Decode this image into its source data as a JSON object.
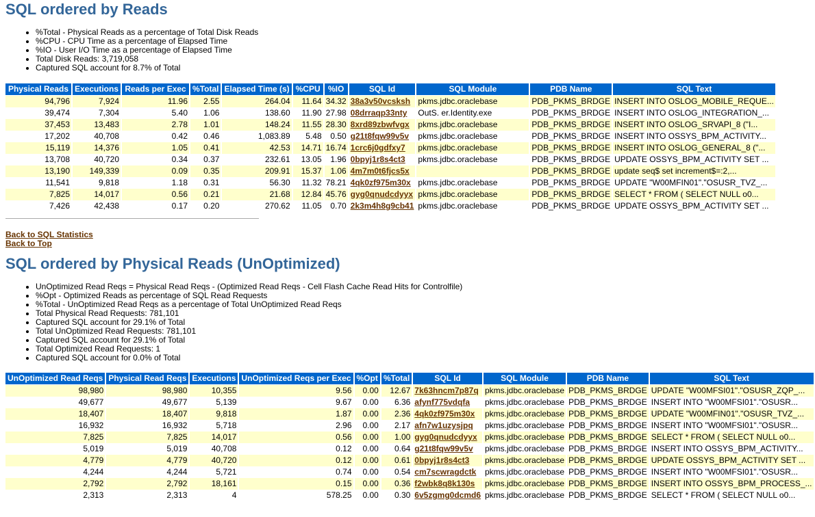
{
  "section1": {
    "title": "SQL ordered by Reads",
    "notes": [
      "%Total - Physical Reads as a percentage of Total Disk Reads",
      "%CPU - CPU Time as a percentage of Elapsed Time",
      "%IO - User I/O Time as a percentage of Elapsed Time",
      "Total Disk Reads: 3,719,058",
      "Captured SQL account for 8.7% of Total"
    ],
    "columns": [
      "Physical Reads",
      "Executions",
      "Reads per Exec",
      "%Total",
      "Elapsed Time (s)",
      "%CPU",
      "%IO",
      "SQL Id",
      "SQL Module",
      "PDB Name",
      "SQL Text"
    ],
    "rows": [
      [
        "94,796",
        "7,924",
        "11.96",
        "2.55",
        "264.04",
        "11.64",
        "34.32",
        "38a3v50vcsksh",
        "pkms.jdbc.oraclebase",
        "PDB_PKMS_BRDGE",
        "INSERT INTO OSLOG_MOBILE_REQUE..."
      ],
      [
        "39,474",
        "7,304",
        "5.40",
        "1.06",
        "138.60",
        "11.90",
        "27.98",
        "08drraqp33nty",
        "OutS.                    er.Identity.exe",
        "PDB_PKMS_BRDGE",
        "INSERT INTO OSLOG_INTEGRATION_..."
      ],
      [
        "37,453",
        "13,483",
        "2.78",
        "1.01",
        "148.24",
        "11.55",
        "28.30",
        "8xrd89zbwfvgx",
        "pkms.jdbc.oraclebase",
        "PDB_PKMS_BRDGE",
        "INSERT INTO OSLOG_SRVAPI_8 (\"I..."
      ],
      [
        "17,202",
        "40,708",
        "0.42",
        "0.46",
        "1,083.89",
        "5.48",
        "0.50",
        "g21t8fqw99v5v",
        "pkms.jdbc.oraclebase",
        "PDB_PKMS_BRDGE",
        "INSERT INTO OSSYS_BPM_ACTIVITY..."
      ],
      [
        "15,119",
        "14,376",
        "1.05",
        "0.41",
        "42.53",
        "14.71",
        "16.74",
        "1crc6j0gdfxy7",
        "pkms.jdbc.oraclebase",
        "PDB_PKMS_BRDGE",
        "INSERT INTO OSLOG_GENERAL_8 (\"..."
      ],
      [
        "13,708",
        "40,720",
        "0.34",
        "0.37",
        "232.61",
        "13.05",
        "1.96",
        "0bpyj1r8s4ct3",
        "pkms.jdbc.oraclebase",
        "PDB_PKMS_BRDGE",
        "UPDATE OSSYS_BPM_ACTIVITY SET ..."
      ],
      [
        "13,190",
        "149,339",
        "0.09",
        "0.35",
        "209.91",
        "15.37",
        "1.06",
        "4m7m0t6fjcs5x",
        "",
        "PDB_PKMS_BRDGE",
        "update seq$ set increment$=:2,..."
      ],
      [
        "11,541",
        "9,818",
        "1.18",
        "0.31",
        "56.30",
        "11.32",
        "78.21",
        "4qk0zf975m30x",
        "pkms.jdbc.oraclebase",
        "PDB_PKMS_BRDGE",
        "UPDATE \"W00MFIN01\".\"OSUSR_TVZ_..."
      ],
      [
        "7,825",
        "14,017",
        "0.56",
        "0.21",
        "21.68",
        "12.84",
        "45.76",
        "gyg0qnudcdyyx",
        "pkms.jdbc.oraclebase",
        "PDB_PKMS_BRDGE",
        "SELECT * FROM ( SELECT NULL o0..."
      ],
      [
        "7,426",
        "42,438",
        "0.17",
        "0.20",
        "270.62",
        "11.05",
        "0.70",
        "2k3m4h8g9cb41",
        "pkms.jdbc.oraclebase",
        "PDB_PKMS_BRDGE",
        "UPDATE OSSYS_BPM_ACTIVITY SET ..."
      ]
    ]
  },
  "links": {
    "back_to_sql_statistics": "Back to SQL Statistics",
    "back_to_top": "Back to Top"
  },
  "section2": {
    "title": "SQL ordered by Physical Reads (UnOptimized)",
    "notes": [
      "UnOptimized Read Reqs = Physical Read Reqs - (Optimized Read Reqs - Cell Flash Cache Read Hits for Controlfile)",
      "%Opt - Optimized Reads as percentage of SQL Read Requests",
      "%Total - UnOptimized Read Reqs as a percentage of Total UnOptimized Read Reqs",
      "Total Physical Read Requests: 781,101",
      "Captured SQL account for 29.1% of Total",
      "Total UnOptimized Read Requests: 781,101",
      "Captured SQL account for 29.1% of Total",
      "Total Optimized Read Requests: 1",
      "Captured SQL account for 0.0% of Total"
    ],
    "columns": [
      "UnOptimized Read Reqs",
      "Physical Read Reqs",
      "Executions",
      "UnOptimized Reqs per Exec",
      "%Opt",
      "%Total",
      "SQL Id",
      "SQL Module",
      "PDB Name",
      "SQL Text"
    ],
    "rows": [
      [
        "98,980",
        "98,980",
        "10,355",
        "9.56",
        "0.00",
        "12.67",
        "7k63hncm7p87q",
        "pkms.jdbc.oraclebase",
        "PDB_PKMS_BRDGE",
        "UPDATE \"W00MFSI01\".\"OSUSR_ZQP_..."
      ],
      [
        "49,677",
        "49,677",
        "5,139",
        "9.67",
        "0.00",
        "6.36",
        "afynf775vdqfa",
        "pkms.jdbc.oraclebase",
        "PDB_PKMS_BRDGE",
        "INSERT INTO \"W00MFSI01\".\"OSUSR..."
      ],
      [
        "18,407",
        "18,407",
        "9,818",
        "1.87",
        "0.00",
        "2.36",
        "4qk0zf975m30x",
        "pkms.jdbc.oraclebase",
        "PDB_PKMS_BRDGE",
        "UPDATE \"W00MFIN01\".\"OSUSR_TVZ_..."
      ],
      [
        "16,932",
        "16,932",
        "5,718",
        "2.96",
        "0.00",
        "2.17",
        "afn7w1uzysjpq",
        "pkms.jdbc.oraclebase",
        "PDB_PKMS_BRDGE",
        "INSERT INTO \"W00MFSI01\".\"OSUSR..."
      ],
      [
        "7,825",
        "7,825",
        "14,017",
        "0.56",
        "0.00",
        "1.00",
        "gyg0qnudcdyyx",
        "pkms.jdbc.oraclebase",
        "PDB_PKMS_BRDGE",
        "SELECT * FROM ( SELECT NULL o0..."
      ],
      [
        "5,019",
        "5,019",
        "40,708",
        "0.12",
        "0.00",
        "0.64",
        "g21t8fqw99v5v",
        "pkms.jdbc.oraclebase",
        "PDB_PKMS_BRDGE",
        "INSERT INTO OSSYS_BPM_ACTIVITY..."
      ],
      [
        "4,779",
        "4,779",
        "40,720",
        "0.12",
        "0.00",
        "0.61",
        "0bpyj1r8s4ct3",
        "pkms.jdbc.oraclebase",
        "PDB_PKMS_BRDGE",
        "UPDATE OSSYS_BPM_ACTIVITY SET ..."
      ],
      [
        "4,244",
        "4,244",
        "5,721",
        "0.74",
        "0.00",
        "0.54",
        "cm7scwragdctk",
        "pkms.jdbc.oraclebase",
        "PDB_PKMS_BRDGE",
        "INSERT INTO \"W00MFSI01\".\"OSUSR..."
      ],
      [
        "2,792",
        "2,792",
        "18,161",
        "0.15",
        "0.00",
        "0.36",
        "f2wbk8q8k130s",
        "pkms.jdbc.oraclebase",
        "PDB_PKMS_BRDGE",
        "INSERT INTO OSSYS_BPM_PROCESS_..."
      ],
      [
        "2,313",
        "2,313",
        "4",
        "578.25",
        "0.00",
        "0.30",
        "6v5zgmg0dcmd6",
        "pkms.jdbc.oraclebase",
        "PDB_PKMS_BRDGE",
        "SELECT * FROM ( SELECT NULL o0..."
      ]
    ]
  },
  "colors": {
    "heading": "#336699",
    "header_bg": "#0066cc",
    "row_highlight": "#ffffcc",
    "link": "#663300"
  }
}
